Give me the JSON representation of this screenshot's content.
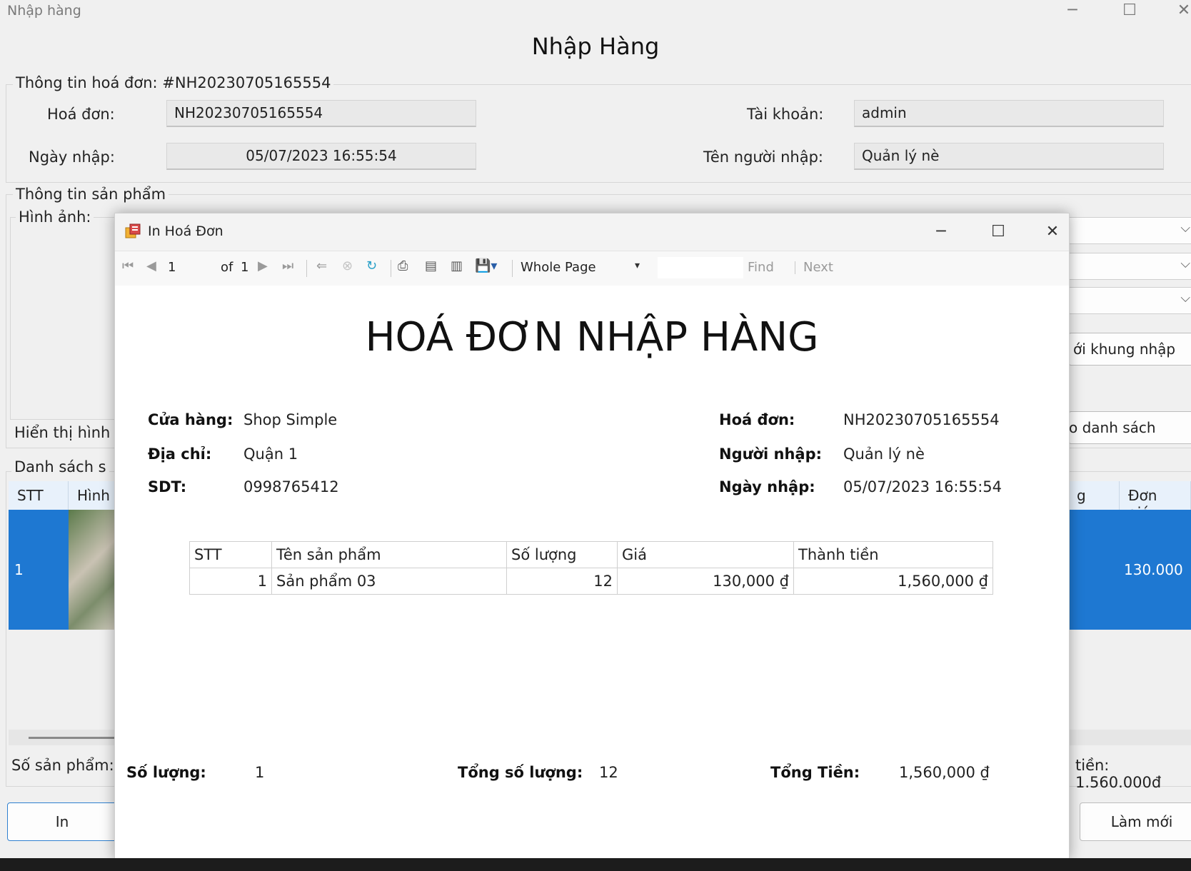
{
  "window": {
    "title": "Nhập hàng",
    "heading": "Nhập Hàng"
  },
  "invoice_info": {
    "legend": "Thông tin hoá đơn: #NH20230705165554",
    "invoice_label": "Hoá đơn:",
    "invoice_value": "NH20230705165554",
    "date_label": "Ngày nhập:",
    "date_value": "05/07/2023 16:55:54",
    "account_label": "Tài khoản:",
    "account_value": "admin",
    "importer_label": "Tên người nhập:",
    "importer_value": "Quản lý nè"
  },
  "product_info": {
    "legend": "Thông tin sản phẩm",
    "image_label": "Hình ảnh:",
    "show_image_label": "Hiển thị hình",
    "refresh_frame_btn": "ới khung nhập",
    "add_list_btn": "o danh sách"
  },
  "list_section": {
    "legend": "Danh sách s",
    "columns": [
      "STT",
      "Hình",
      "g",
      "Đơn giá"
    ],
    "row": {
      "stt": "1",
      "price": "130.000"
    },
    "count_label": "Số sản phẩm:",
    "total_label": "tiền: 1.560.000đ"
  },
  "buttons": {
    "print": "In",
    "reset": "Làm mới"
  },
  "dialog": {
    "title": "In Hoá Đơn",
    "toolbar": {
      "page": "1",
      "of": "of",
      "total_pages": "1",
      "zoom": "Whole Page",
      "find": "Find",
      "next": "Next"
    }
  },
  "report": {
    "title": "HOÁ ĐƠN NHẬP HÀNG",
    "store_label": "Cửa hàng:",
    "store_value": "Shop Simple",
    "address_label": "Địa chỉ:",
    "address_value": "Quận 1",
    "phone_label": "SDT:",
    "phone_value": "0998765412",
    "invoice_label": "Hoá đơn:",
    "invoice_value": "NH20230705165554",
    "importer_label": "Người nhập:",
    "importer_value": "Quản lý nè",
    "date_label": "Ngày nhập:",
    "date_value": "05/07/2023 16:55:54",
    "table": {
      "headers": [
        "STT",
        "Tên sản phẩm",
        "Số lượng",
        "Giá",
        "Thành tiền"
      ],
      "rows": [
        [
          "1",
          "Sản phẩm 03",
          "12",
          "130,000 ₫",
          "1,560,000 ₫"
        ]
      ]
    },
    "qty_label": "Số lượng:",
    "qty_value": "1",
    "total_qty_label": "Tổng số lượng:",
    "total_qty_value": "12",
    "total_label": "Tổng Tiền:",
    "total_value": "1,560,000 ₫"
  }
}
